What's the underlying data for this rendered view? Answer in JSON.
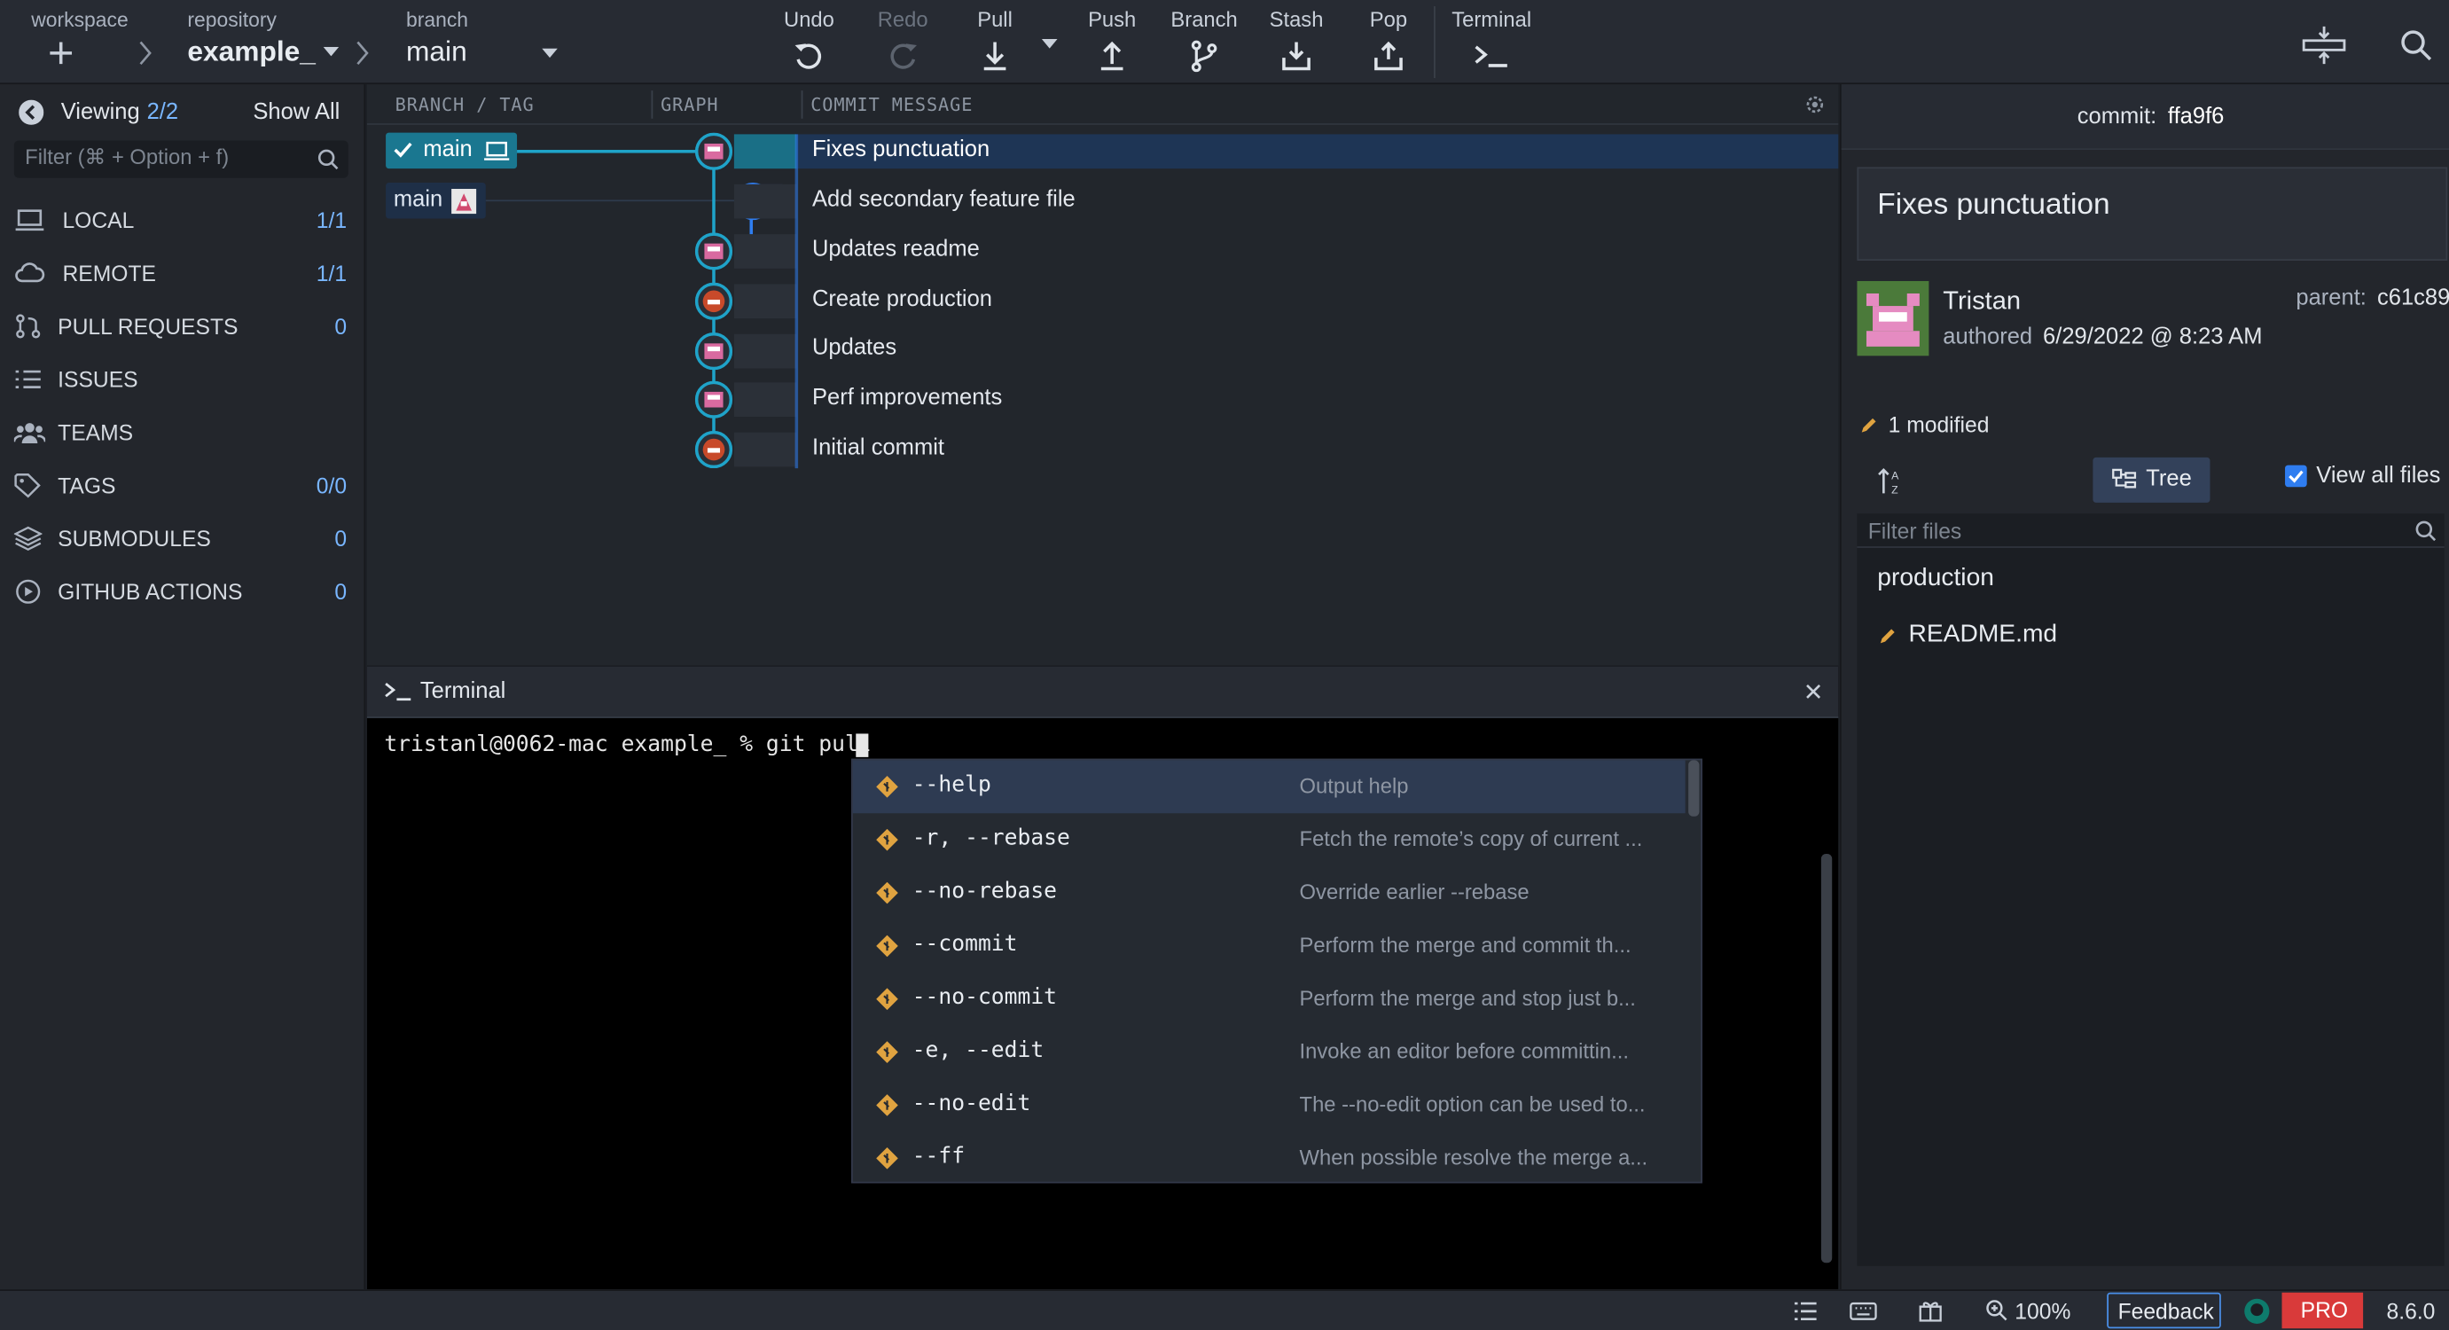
{
  "toolbar": {
    "workspace_label": "workspace",
    "repository_label": "repository",
    "repository_name": "example_",
    "branch_label": "branch",
    "branch_name": "main",
    "undo": "Undo",
    "redo": "Redo",
    "pull": "Pull",
    "push": "Push",
    "branch": "Branch",
    "stash": "Stash",
    "pop": "Pop",
    "terminal": "Terminal"
  },
  "sidebar": {
    "viewing_label": "Viewing",
    "viewing_count": "2/2",
    "show_all": "Show All",
    "filter_placeholder": "Filter (⌘ + Option + f)",
    "items": [
      {
        "label": "LOCAL",
        "count": "1/1",
        "icon": "laptop-icon"
      },
      {
        "label": "REMOTE",
        "count": "1/1",
        "icon": "cloud-icon"
      },
      {
        "label": "PULL REQUESTS",
        "count": "0",
        "icon": "pull-request-icon"
      },
      {
        "label": "ISSUES",
        "count": "",
        "icon": "list-icon"
      },
      {
        "label": "TEAMS",
        "count": "",
        "icon": "users-icon"
      },
      {
        "label": "TAGS",
        "count": "0/0",
        "icon": "tag-icon"
      },
      {
        "label": "SUBMODULES",
        "count": "0",
        "icon": "layers-icon"
      },
      {
        "label": "GITHUB ACTIONS",
        "count": "0",
        "icon": "play-circle-icon"
      }
    ]
  },
  "graph": {
    "col_branch": "BRANCH / TAG",
    "col_graph": "GRAPH",
    "col_message": "COMMIT MESSAGE",
    "branch_local": "main",
    "branch_remote": "main",
    "commits": [
      "Fixes punctuation",
      "Add secondary feature file",
      "Updates readme",
      "Create production",
      "Updates",
      "Perf improvements",
      "Initial commit"
    ]
  },
  "terminal": {
    "title": "Terminal",
    "prompt": "tristanl@0062-mac example_ % git pull ",
    "suggestions": [
      {
        "option": "--help",
        "desc": "Output help"
      },
      {
        "option": "-r, --rebase",
        "desc": "Fetch the remote’s copy of current ..."
      },
      {
        "option": "--no-rebase",
        "desc": "Override earlier --rebase"
      },
      {
        "option": "--commit",
        "desc": "Perform the merge and commit th..."
      },
      {
        "option": "--no-commit",
        "desc": "Perform the merge and stop just b..."
      },
      {
        "option": "-e, --edit",
        "desc": "Invoke an editor before committin..."
      },
      {
        "option": "--no-edit",
        "desc": "The --no-edit option can be used to..."
      },
      {
        "option": "--ff",
        "desc": "When possible resolve the merge a..."
      }
    ]
  },
  "details": {
    "commit_label": "commit:",
    "commit_sha": "ffa9f6",
    "message": "Fixes punctuation",
    "author": "Tristan",
    "authored_label": "authored",
    "authored_date": "6/29/2022 @ 8:23 AM",
    "parent_label": "parent:",
    "parent_sha": "c61c89",
    "modified": "1 modified",
    "tree_label": "Tree",
    "view_all_files": "View all files",
    "filter_placeholder": "Filter files",
    "folder": "production",
    "file": "README.md"
  },
  "status": {
    "zoom": "100%",
    "feedback": "Feedback",
    "pro": "PRO",
    "version": "8.6.0"
  },
  "colors": {
    "accent": "#1fa3c9",
    "selected_row": "#1e3555",
    "modified": "#e0a340",
    "pro": "#d93a3a"
  }
}
